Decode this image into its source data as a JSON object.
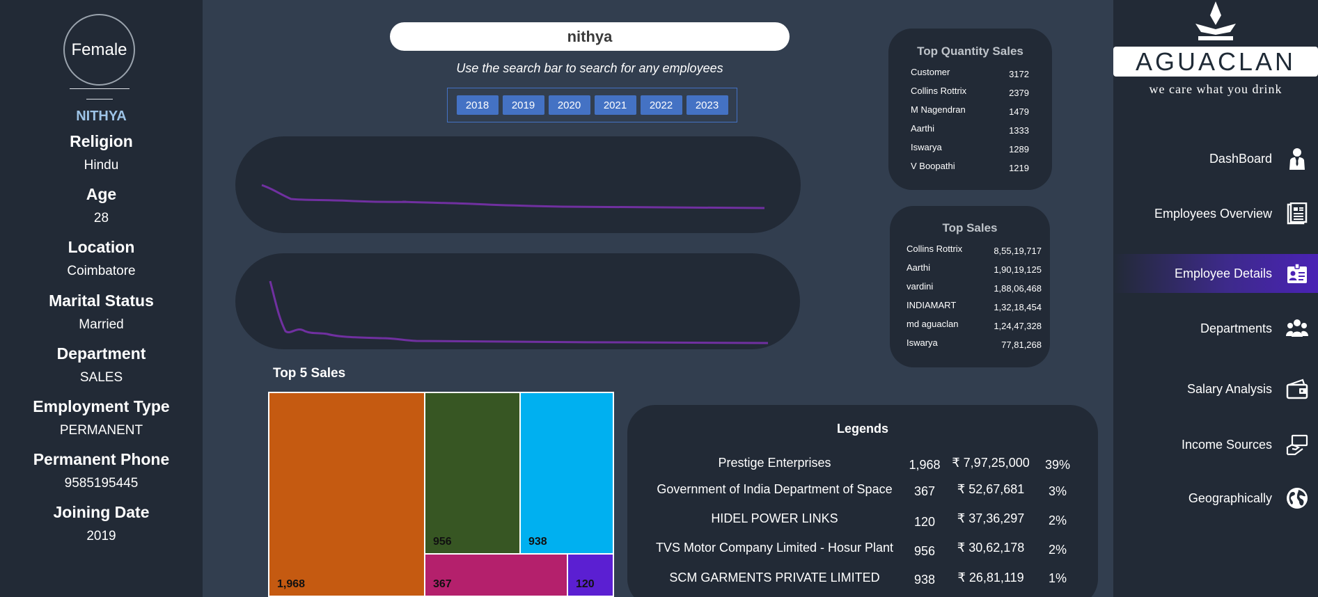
{
  "profile": {
    "gender": "Female",
    "name": "NITHYA",
    "fields": [
      {
        "key": "Religion",
        "value": "Hindu"
      },
      {
        "key": "Age",
        "value": "28"
      },
      {
        "key": "Location",
        "value": "Coimbatore"
      },
      {
        "key": "Marital Status",
        "value": "Married"
      },
      {
        "key": "Department",
        "value": "SALES"
      },
      {
        "key": "Employment Type",
        "value": "PERMANENT"
      },
      {
        "key": "Permanent Phone",
        "value": "9585195445"
      },
      {
        "key": "Joining Date",
        "value": "2019"
      }
    ]
  },
  "search": {
    "value": "nithya",
    "hint": "Use the search bar to search for any employees"
  },
  "years": [
    "2018",
    "2019",
    "2020",
    "2021",
    "2022",
    "2023"
  ],
  "top5": {
    "title": "Top 5 Sales",
    "values": [
      "1,968",
      "956",
      "938",
      "367",
      "120"
    ],
    "colors": {
      "1968": "#c55a11",
      "956": "#375623",
      "938": "#00b0f0",
      "367": "#b4206c",
      "120": "#5b1fd2"
    }
  },
  "legends": {
    "title": "Legends",
    "rows": [
      {
        "name": "Prestige Enterprises",
        "count": "1,968",
        "amount": "₹ 7,97,25,000",
        "pct": "39%"
      },
      {
        "name": "Government of India Department of Space",
        "count": "367",
        "amount": "₹ 52,67,681",
        "pct": "3%"
      },
      {
        "name": "HIDEL POWER LINKS",
        "count": "120",
        "amount": "₹ 37,36,297",
        "pct": "2%"
      },
      {
        "name": "TVS Motor Company Limited - Hosur Plant",
        "count": "956",
        "amount": "₹ 30,62,178",
        "pct": "2%"
      },
      {
        "name": "SCM GARMENTS PRIVATE LIMITED",
        "count": "938",
        "amount": "₹ 26,81,119",
        "pct": "1%"
      }
    ]
  },
  "top_quantity": {
    "title": "Top Quantity Sales",
    "rows": [
      {
        "name": "Customer",
        "value": "3172"
      },
      {
        "name": "Collins Rottrix",
        "value": "2379"
      },
      {
        "name": "M Nagendran",
        "value": "1479"
      },
      {
        "name": "Aarthi",
        "value": "1333"
      },
      {
        "name": "Iswarya",
        "value": "1289"
      },
      {
        "name": "V Boopathi",
        "value": "1219"
      }
    ]
  },
  "top_sales": {
    "title": "Top Sales",
    "rows": [
      {
        "name": "Collins Rottrix",
        "value": "8,55,19,717"
      },
      {
        "name": "Aarthi",
        "value": "1,90,19,125"
      },
      {
        "name": "vardini",
        "value": "1,88,06,468"
      },
      {
        "name": "INDIAMART",
        "value": "1,32,18,454"
      },
      {
        "name": "md aguaclan",
        "value": "1,24,47,328"
      },
      {
        "name": "Iswarya",
        "value": "77,81,268"
      }
    ]
  },
  "brand": {
    "logo_text": "AGUACLAN",
    "tagline": "we care what you drink"
  },
  "nav": [
    {
      "label": "DashBoard",
      "icon": "businessman-icon",
      "active": false
    },
    {
      "label": "Employees Overview",
      "icon": "document-icon",
      "active": false
    },
    {
      "label": "Employee Details",
      "icon": "id-card-icon",
      "active": true
    },
    {
      "label": "Departments",
      "icon": "group-icon",
      "active": false
    },
    {
      "label": "Salary Analysis",
      "icon": "wallet-icon",
      "active": false
    },
    {
      "label": "Income Sources",
      "icon": "hand-money-icon",
      "active": false
    },
    {
      "label": "Geographically",
      "icon": "globe-icon",
      "active": false
    }
  ],
  "colors": {
    "background": "#323e4f",
    "panel": "#222a36",
    "accent_blue": "#4472c4",
    "name_color": "#9dc3e6",
    "spark_line": "#7030a0",
    "nav_active": "#4a22b5"
  }
}
